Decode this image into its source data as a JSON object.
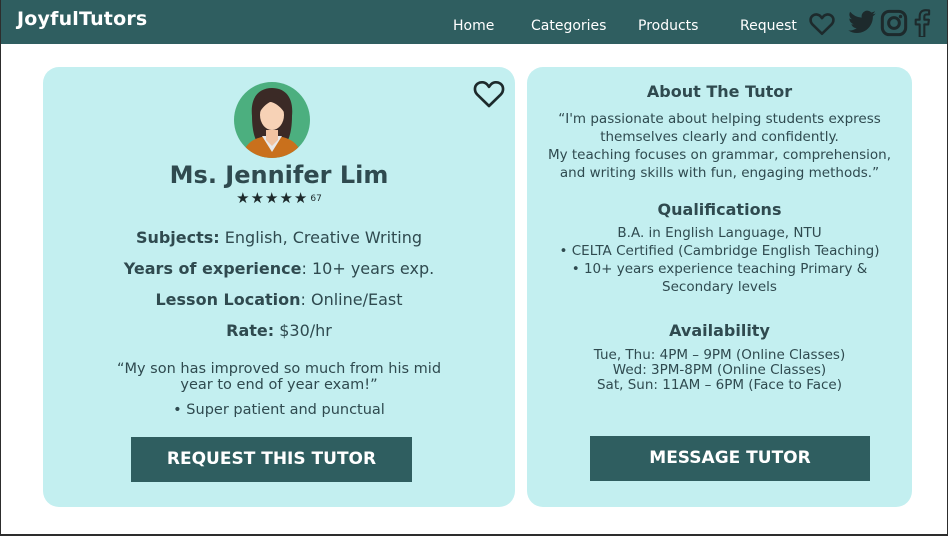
{
  "brand": {
    "name": "JoyfulTutors"
  },
  "nav": {
    "links": [
      "Home",
      "Categories",
      "Products",
      "Request"
    ],
    "icons": [
      "heart-icon",
      "twitter-icon",
      "instagram-icon",
      "facebook-icon"
    ]
  },
  "tutor": {
    "name": "Ms. Jennifer Lim",
    "stars": 5,
    "star_glyphs": "★★★★★",
    "rating_count": "67",
    "subjects_label": "Subjects:",
    "subjects_value": " English, Creative Writing",
    "experience_label": "Years of experience",
    "experience_value": ": 10+ years exp.",
    "location_label": "Lesson Location",
    "location_value": ": Online/East",
    "rate_label": "Rate:",
    "rate_value": " $30/hr",
    "review_quote": "“My son has improved so much from his mid year to end of year exam!”",
    "review_bullet": "•  Super patient and punctual",
    "request_button": "REQUEST THIS TUTOR"
  },
  "about": {
    "title": "About The Tutor",
    "lines": [
      "“I'm passionate about helping students express",
      "themselves clearly and confidently.",
      "My teaching focuses on grammar, comprehension,",
      "and writing skills with fun, engaging methods.”"
    ]
  },
  "qualifications": {
    "title": "Qualifications",
    "lines": [
      "B.A. in English Language, NTU",
      "• CELTA Certified (Cambridge English Teaching)",
      "• 10+ years experience teaching Primary &",
      "Secondary levels"
    ]
  },
  "availability": {
    "title": "Availability",
    "lines": [
      "Tue, Thu: 4PM – 9PM (Online Classes)",
      "Wed: 3PM-8PM (Online Classes)",
      "Sat, Sun: 11AM – 6PM (Face to Face)"
    ]
  },
  "message_button": "MESSAGE TUTOR",
  "colors": {
    "navbar": "#2f5e60",
    "card": "#c3eff0",
    "button": "#2f5e60",
    "text": "#2f4a4f"
  }
}
